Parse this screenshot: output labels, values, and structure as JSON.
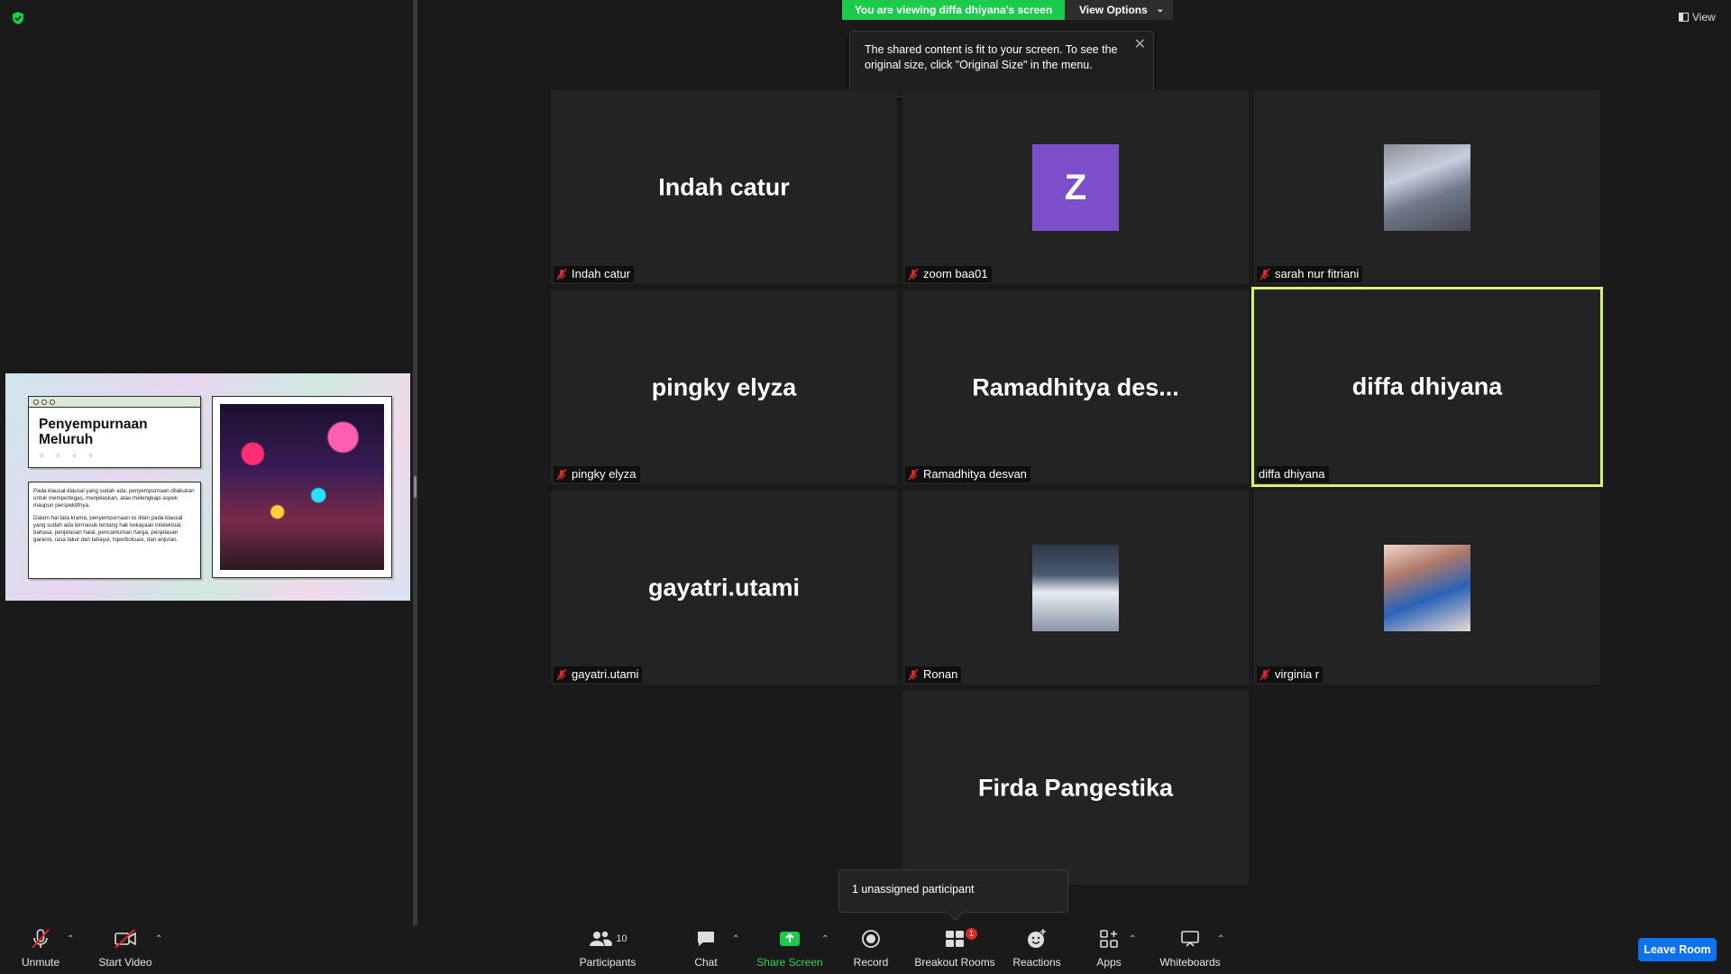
{
  "banner": {
    "viewing_text": "You are viewing diffa dhiyana's screen",
    "view_options_label": "View Options",
    "view_label": "View"
  },
  "tooltip": {
    "text": "The shared content is fit to your screen. To see the original size, click \"Original Size\" in the menu."
  },
  "shared_slide": {
    "title": "Penyempurnaan Meluruh",
    "dots": "○ ○ ○ ○",
    "paragraph_1": "Pada klausal-klausal yang sudah ada, penyempurnaan dilakukan untuk mempertegas, menjelaskan, atau melengkapi aspek maupun perspektifnya.",
    "paragraph_2": "Dalam hal tata krama, penyempurnaan isi iklan pada klausal yang sudah ada termasuk tentang hak kekayaan intelektual, bahasa, penjelasan halal, pencantuman harga, penjelasan garansi, rasa takut dan tahayul, hiperbolisasi, dan anjuran."
  },
  "participants": [
    {
      "display": "Indah catur",
      "label": "Indah catur",
      "muted": true,
      "kind": "name"
    },
    {
      "display": "Z",
      "label": "zoom baa01",
      "muted": true,
      "kind": "letter",
      "color": "#7b4fc9"
    },
    {
      "display": "",
      "label": "sarah nur fitriani",
      "muted": true,
      "kind": "photo"
    },
    {
      "display": "pingky elyza",
      "label": "pingky elyza",
      "muted": true,
      "kind": "name"
    },
    {
      "display": "Ramadhitya  des...",
      "label": "Ramadhitya desvan",
      "muted": true,
      "kind": "name"
    },
    {
      "display": "diffa dhiyana",
      "label": "diffa dhiyana",
      "muted": false,
      "kind": "name",
      "active": true
    },
    {
      "display": "gayatri.utami",
      "label": "gayatri.utami",
      "muted": true,
      "kind": "name"
    },
    {
      "display": "",
      "label": "Ronan",
      "muted": true,
      "kind": "photo"
    },
    {
      "display": "",
      "label": "virginia r",
      "muted": true,
      "kind": "photo"
    },
    {
      "display": "Firda Pangestika",
      "label": "",
      "muted": false,
      "kind": "name"
    }
  ],
  "unassigned": {
    "text": "1 unassigned participant"
  },
  "toolbar": {
    "unmute": "Unmute",
    "start_video": "Start Video",
    "participants": "Participants",
    "participants_count": "10",
    "chat": "Chat",
    "share_screen": "Share Screen",
    "record": "Record",
    "breakout_rooms": "Breakout Rooms",
    "breakout_badge": "1",
    "reactions": "Reactions",
    "apps": "Apps",
    "whiteboards": "Whiteboards",
    "leave_room": "Leave Room"
  },
  "colors": {
    "accent_green": "#1ccb4b",
    "active_speaker": "#d6f07a",
    "leave_blue": "#0e72ed",
    "muted_red": "#e02828"
  }
}
